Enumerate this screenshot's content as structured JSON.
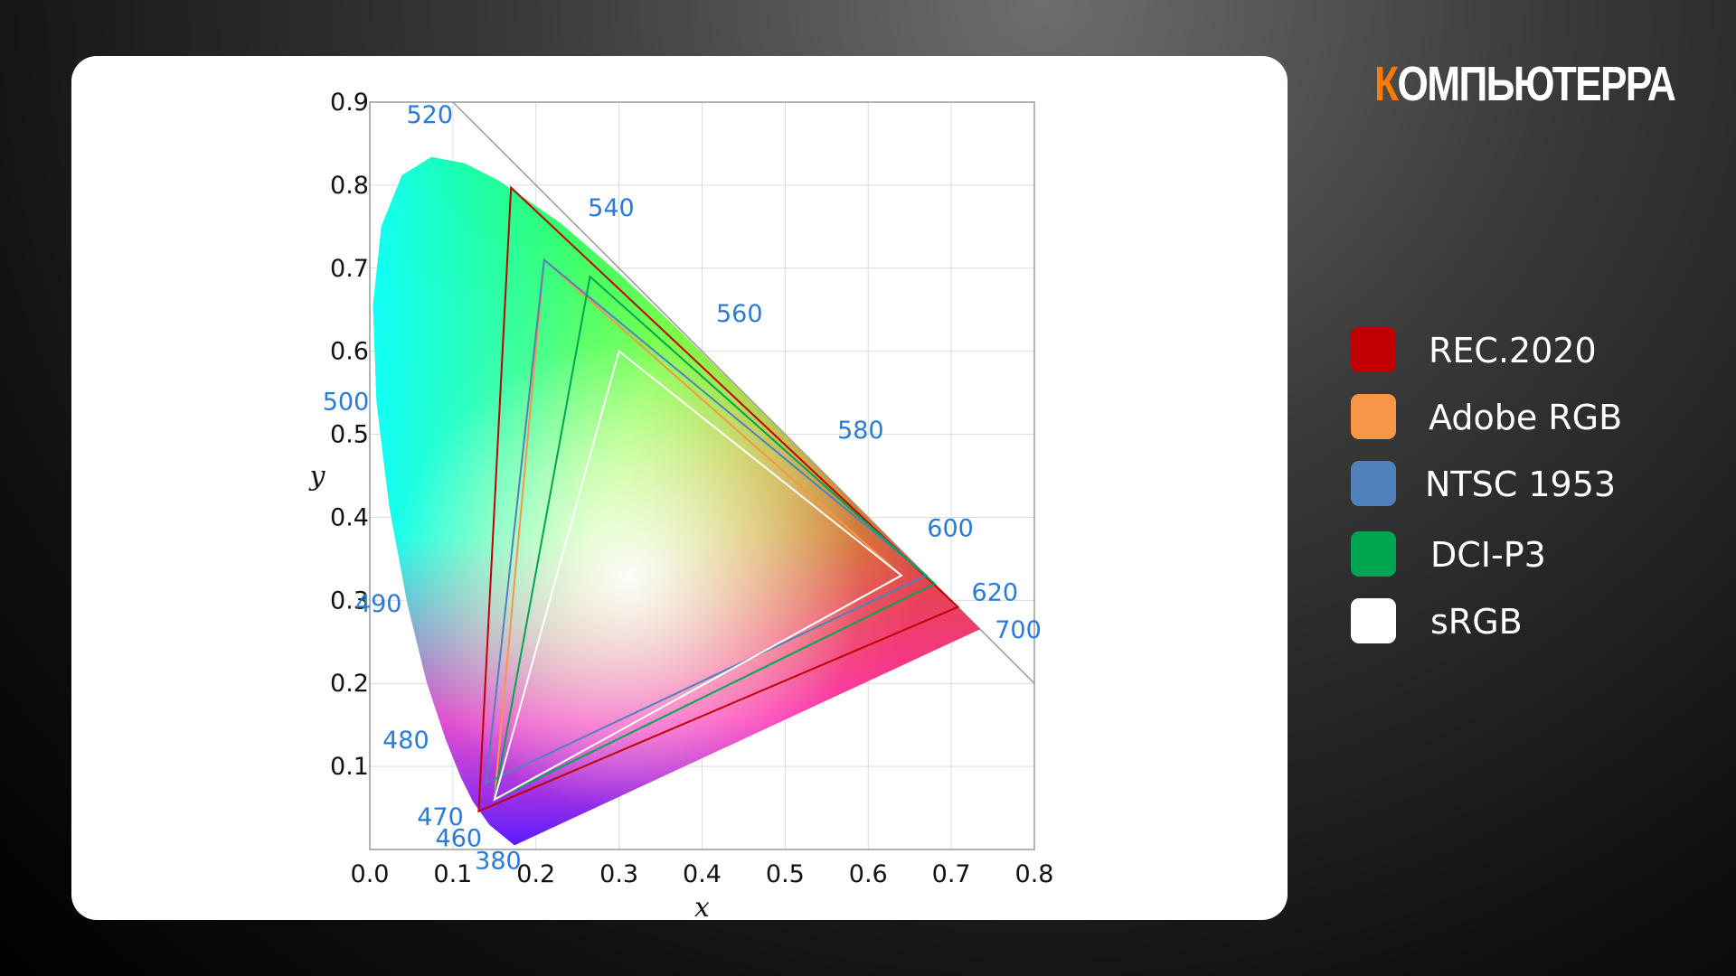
{
  "brand": {
    "accent_letter": "К",
    "rest": "ОМПЬЮТЕРРА",
    "accent_color": "#ff7a00"
  },
  "legend": [
    {
      "label": "REC.2020",
      "color": "#c00000"
    },
    {
      "label": "Adobe RGB",
      "color": "#f79646"
    },
    {
      "label": "NTSC 1953",
      "color": "#4f81bd"
    },
    {
      "label": "DCI-P3",
      "color": "#00a550"
    },
    {
      "label": "sRGB",
      "color": "#ffffff"
    }
  ],
  "chart_data": {
    "type": "scatter",
    "xlabel": "x",
    "ylabel": "y",
    "xlim": [
      0,
      0.8
    ],
    "ylim": [
      0,
      0.9
    ],
    "xticks": [
      "0.0",
      "0.1",
      "0.2",
      "0.3",
      "0.4",
      "0.5",
      "0.6",
      "0.7",
      "0.8"
    ],
    "yticks": [
      "0.1",
      "0.2",
      "0.3",
      "0.4",
      "0.5",
      "0.6",
      "0.7",
      "0.8",
      "0.9"
    ],
    "grid": true,
    "legend_position": "right",
    "spectral_locus": [
      {
        "nm": 380,
        "x": 0.1741,
        "y": 0.005
      },
      {
        "nm": 460,
        "x": 0.144,
        "y": 0.0297
      },
      {
        "nm": 470,
        "x": 0.1241,
        "y": 0.0578
      },
      {
        "nm": 475,
        "x": 0.1096,
        "y": 0.0868
      },
      {
        "nm": 480,
        "x": 0.0913,
        "y": 0.1327
      },
      {
        "nm": 485,
        "x": 0.0687,
        "y": 0.2007
      },
      {
        "nm": 490,
        "x": 0.0454,
        "y": 0.295
      },
      {
        "nm": 495,
        "x": 0.0235,
        "y": 0.4127
      },
      {
        "nm": 500,
        "x": 0.0082,
        "y": 0.5384
      },
      {
        "nm": 505,
        "x": 0.0039,
        "y": 0.6548
      },
      {
        "nm": 510,
        "x": 0.0139,
        "y": 0.7502
      },
      {
        "nm": 515,
        "x": 0.0389,
        "y": 0.812
      },
      {
        "nm": 520,
        "x": 0.0743,
        "y": 0.8338
      },
      {
        "nm": 525,
        "x": 0.1142,
        "y": 0.8262
      },
      {
        "nm": 530,
        "x": 0.1547,
        "y": 0.8059
      },
      {
        "nm": 540,
        "x": 0.2296,
        "y": 0.7543
      },
      {
        "nm": 550,
        "x": 0.3016,
        "y": 0.6923
      },
      {
        "nm": 560,
        "x": 0.3731,
        "y": 0.6245
      },
      {
        "nm": 570,
        "x": 0.4441,
        "y": 0.5547
      },
      {
        "nm": 580,
        "x": 0.5125,
        "y": 0.4866
      },
      {
        "nm": 590,
        "x": 0.5752,
        "y": 0.4242
      },
      {
        "nm": 600,
        "x": 0.627,
        "y": 0.3725
      },
      {
        "nm": 610,
        "x": 0.6658,
        "y": 0.334
      },
      {
        "nm": 620,
        "x": 0.6915,
        "y": 0.3083
      },
      {
        "nm": 640,
        "x": 0.719,
        "y": 0.2809
      },
      {
        "nm": 700,
        "x": 0.7347,
        "y": 0.2653
      }
    ],
    "wavelength_labels": [
      {
        "text": "380",
        "nm": 380
      },
      {
        "text": "460",
        "nm": 460
      },
      {
        "text": "470",
        "nm": 470
      },
      {
        "text": "480",
        "nm": 480
      },
      {
        "text": "490",
        "nm": 490
      },
      {
        "text": "500",
        "nm": 500
      },
      {
        "text": "520",
        "nm": 520
      },
      {
        "text": "540",
        "nm": 540
      },
      {
        "text": "560",
        "nm": 560
      },
      {
        "text": "580",
        "nm": 580
      },
      {
        "text": "600",
        "nm": 600
      },
      {
        "text": "620",
        "nm": 620
      },
      {
        "text": "700",
        "nm": 700
      }
    ],
    "white_point": {
      "x": 0.3127,
      "y": 0.329
    },
    "series": [
      {
        "name": "REC.2020",
        "color": "#c00000",
        "points": [
          [
            0.708,
            0.292
          ],
          [
            0.17,
            0.797
          ],
          [
            0.131,
            0.046
          ]
        ]
      },
      {
        "name": "Adobe RGB",
        "color": "#f79646",
        "points": [
          [
            0.64,
            0.33
          ],
          [
            0.21,
            0.71
          ],
          [
            0.15,
            0.06
          ]
        ]
      },
      {
        "name": "NTSC 1953",
        "color": "#4f81bd",
        "points": [
          [
            0.67,
            0.33
          ],
          [
            0.21,
            0.71
          ],
          [
            0.14,
            0.08
          ]
        ]
      },
      {
        "name": "DCI-P3",
        "color": "#00a550",
        "points": [
          [
            0.68,
            0.32
          ],
          [
            0.265,
            0.69
          ],
          [
            0.15,
            0.06
          ]
        ]
      },
      {
        "name": "sRGB",
        "color": "#ffffff",
        "points": [
          [
            0.64,
            0.33
          ],
          [
            0.3,
            0.6
          ],
          [
            0.15,
            0.06
          ]
        ]
      }
    ]
  }
}
